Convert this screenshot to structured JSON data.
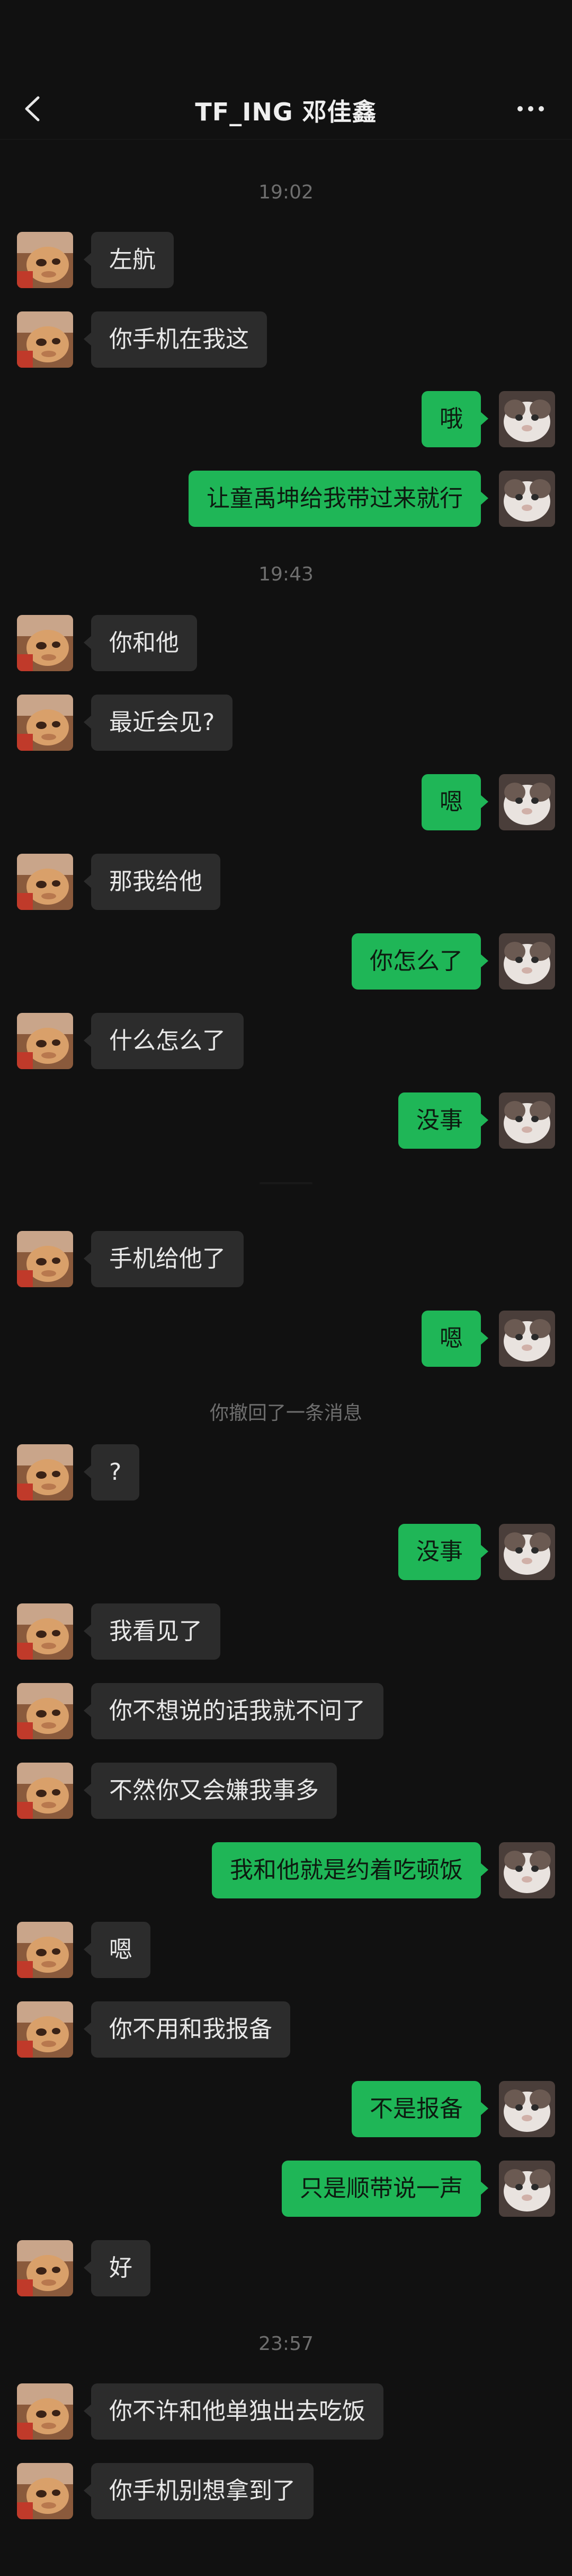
{
  "header": {
    "title": "TF_ING 邓佳鑫"
  },
  "timestamps": {
    "t1": "19:02",
    "t2": "19:43",
    "t3": "23:57"
  },
  "system": {
    "recalled": "你撤回了一条消息"
  },
  "messages": [
    {
      "side": "in",
      "text": "左航"
    },
    {
      "side": "in",
      "text": "你手机在我这"
    },
    {
      "side": "out",
      "text": "哦"
    },
    {
      "side": "out",
      "text": "让童禹坤给我带过来就行"
    },
    {
      "side": "in",
      "text": "你和他"
    },
    {
      "side": "in",
      "text": "最近会见?"
    },
    {
      "side": "out",
      "text": "嗯"
    },
    {
      "side": "in",
      "text": "那我给他"
    },
    {
      "side": "out",
      "text": "你怎么了"
    },
    {
      "side": "in",
      "text": "什么怎么了"
    },
    {
      "side": "out",
      "text": "没事"
    },
    {
      "side": "in",
      "text": "手机给他了"
    },
    {
      "side": "out",
      "text": "嗯"
    },
    {
      "side": "in",
      "text": "?"
    },
    {
      "side": "out",
      "text": "没事"
    },
    {
      "side": "in",
      "text": "我看见了"
    },
    {
      "side": "in",
      "text": "你不想说的话我就不问了"
    },
    {
      "side": "in",
      "text": "不然你又会嫌我事多"
    },
    {
      "side": "out",
      "text": "我和他就是约着吃顿饭"
    },
    {
      "side": "in",
      "text": "嗯"
    },
    {
      "side": "in",
      "text": "你不用和我报备"
    },
    {
      "side": "out",
      "text": "不是报备"
    },
    {
      "side": "out",
      "text": "只是顺带说一声"
    },
    {
      "side": "in",
      "text": "好"
    },
    {
      "side": "in",
      "text": "你不许和他单独出去吃饭"
    },
    {
      "side": "in",
      "text": "你手机别想拿到了"
    }
  ]
}
